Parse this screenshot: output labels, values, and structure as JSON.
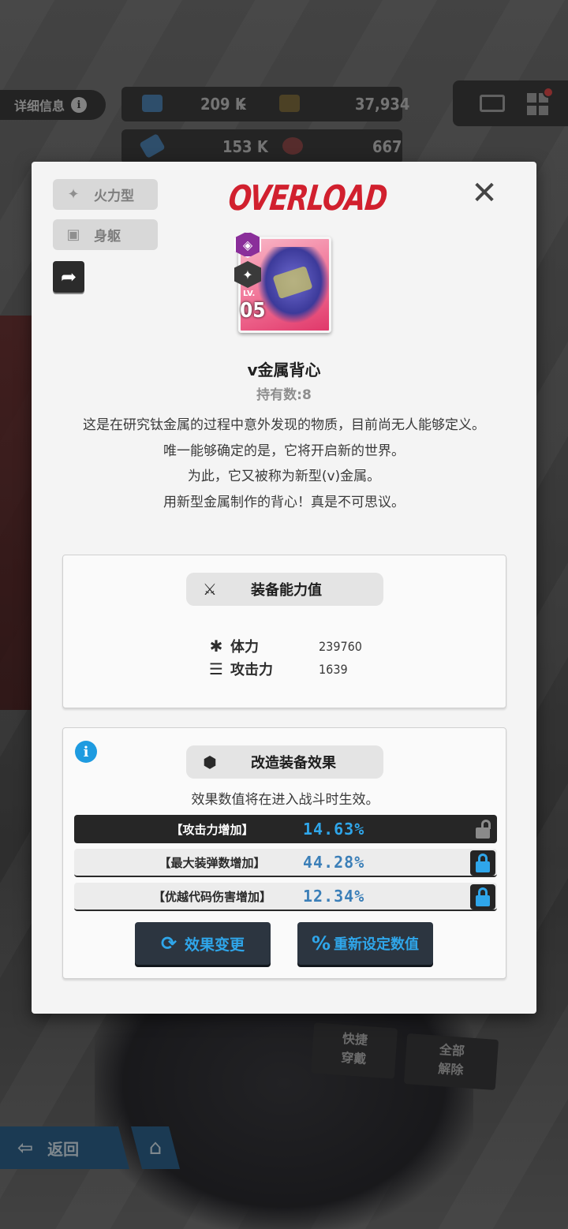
{
  "hud": {
    "info_label": "详细信息",
    "resource1": "209 K",
    "resource1_plus": "+",
    "resource2": "37,934",
    "resource3": "153 K",
    "resource4": "667"
  },
  "bottom": {
    "quick_equip_line1": "快捷",
    "quick_equip_line2": "穿戴",
    "unequip_line1": "全部",
    "unequip_line2": "解除",
    "back_label": "返回"
  },
  "modal": {
    "class_tag": "火力型",
    "slot_tag": "身躯",
    "logo_text": "OVERLOAD",
    "close_symbol": "✕",
    "item": {
      "lv_label": "LV.",
      "level": "05",
      "name": "v金属背心",
      "count": "持有数:8",
      "description": [
        "这是在研究钛金属的过程中意外发现的物质，目前尚无人能够定义。",
        "唯一能够确定的是，它将开启新的世界。",
        "为此，它又被称为新型(v)金属。",
        "用新型金属制作的背心！真是不可思议。"
      ]
    },
    "stats": {
      "title": "装备能力值",
      "hp_label": "体力",
      "hp_value": "239760",
      "atk_label": "攻击力",
      "atk_value": "1639"
    },
    "mods": {
      "title": "改造装备效果",
      "note": "效果数值将在进入战斗时生效。",
      "effects": [
        {
          "name": "【攻击力增加】",
          "value": "14.63%",
          "locked": false
        },
        {
          "name": "【最大装弹数增加】",
          "value": "44.28%",
          "locked": true
        },
        {
          "name": "【优越代码伤害增加】",
          "value": "12.34%",
          "locked": true
        }
      ],
      "change_button": "效果变更",
      "reset_button": "重新设定数值"
    }
  },
  "colors": {
    "accent_blue": "#2fa6ea",
    "overload_red": "#d1202e",
    "rare_pink": "#ef6a90"
  }
}
